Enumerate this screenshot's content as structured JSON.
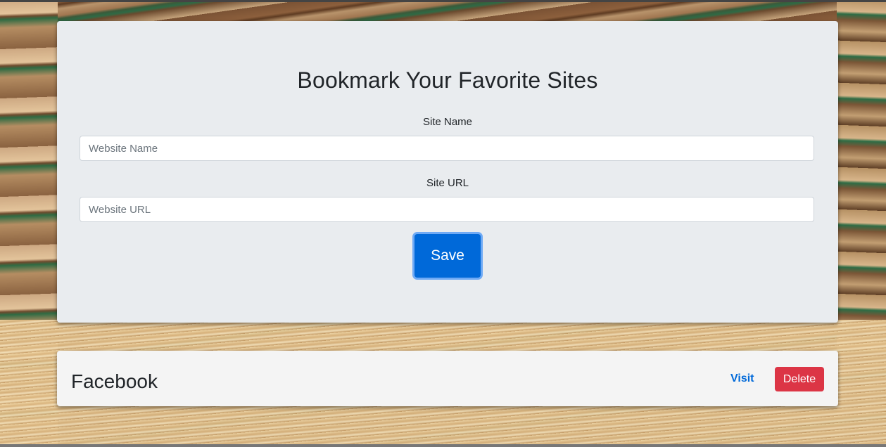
{
  "form": {
    "title": "Bookmark Your Favorite Sites",
    "site_name_label": "Site Name",
    "site_name_placeholder": "Website Name",
    "site_name_value": "",
    "site_url_label": "Site URL",
    "site_url_placeholder": "Website URL",
    "site_url_value": "",
    "save_label": "Save"
  },
  "bookmarks": [
    {
      "name": "Facebook",
      "visit_label": "Visit",
      "delete_label": "Delete"
    }
  ],
  "colors": {
    "primary": "#0069d9",
    "danger": "#dc3545",
    "card_bg": "#e9ecef"
  }
}
